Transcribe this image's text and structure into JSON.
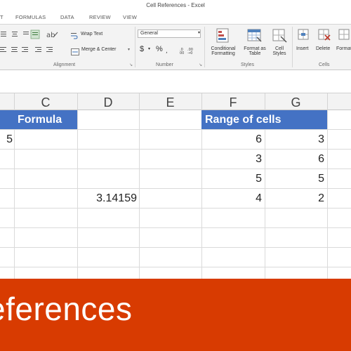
{
  "window": {
    "title": "Cell References - Excel"
  },
  "tabs": [
    "T",
    "FORMULAS",
    "DATA",
    "REVIEW",
    "VIEW"
  ],
  "ribbon": {
    "wrap_text": "Wrap Text",
    "merge_center": "Merge & Center",
    "number_format": "General",
    "currency_symbol": "$",
    "percent_symbol": "%",
    "alignment_label": "Alignment",
    "number_label": "Number",
    "styles_label": "Styles",
    "cells_label": "Cells",
    "conditional_formatting": [
      "Conditional",
      "Formatting"
    ],
    "format_as_table": [
      "Format as",
      "Table"
    ],
    "cell_styles": [
      "Cell",
      "Styles"
    ],
    "insert": "Insert",
    "delete": "Delete",
    "format": "Format"
  },
  "columns": [
    "C",
    "D",
    "E",
    "F",
    "G"
  ],
  "sheet": {
    "b1_partial": "5",
    "header_formula": "Formula",
    "header_range": "Range of cells",
    "d4": "3.14159",
    "f_values": [
      "6",
      "3",
      "5",
      "4"
    ],
    "g_values": [
      "3",
      "6",
      "5",
      "2"
    ]
  },
  "banner": {
    "text": "eferences"
  },
  "colors": {
    "header_fill": "#4472c4",
    "banner": "#d83b01"
  }
}
